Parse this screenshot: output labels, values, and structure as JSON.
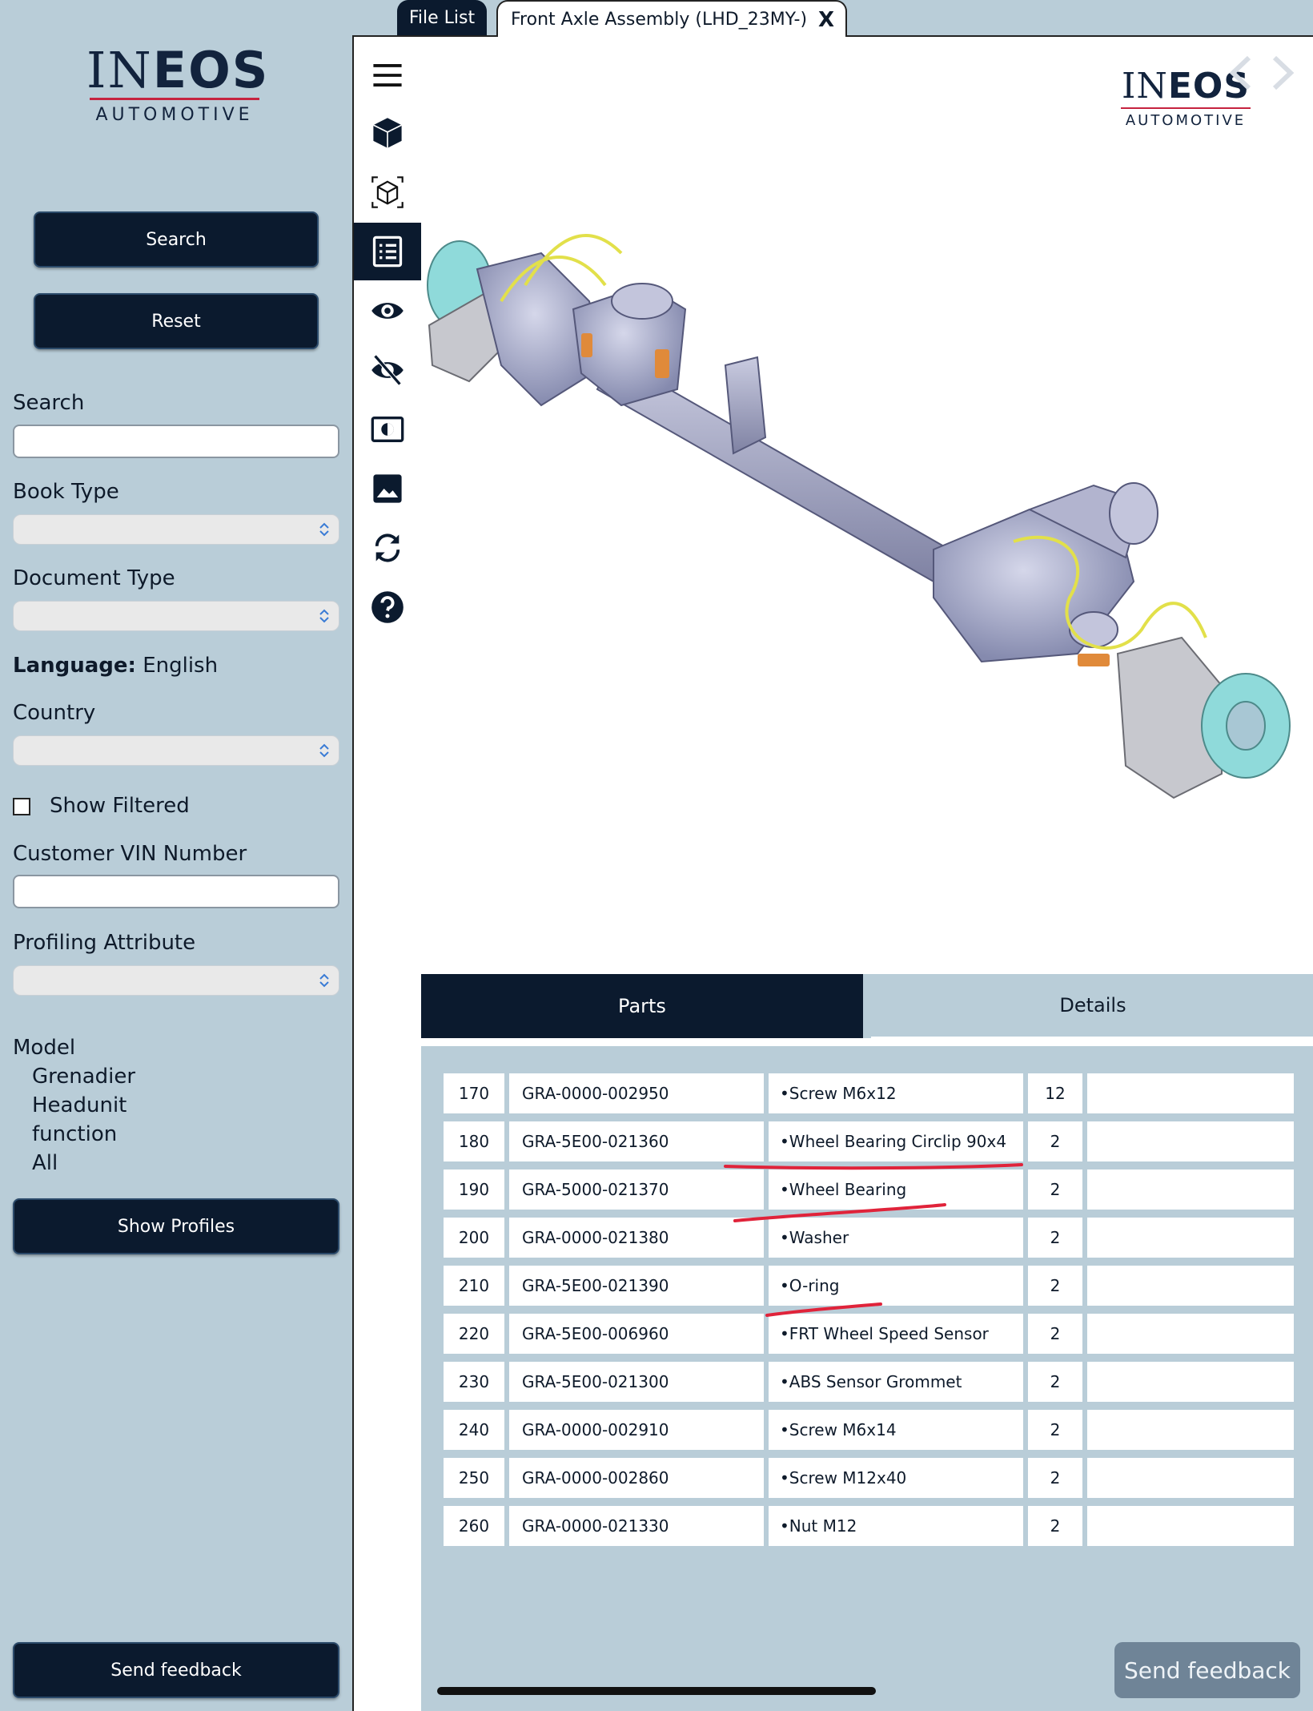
{
  "brand": {
    "name_light": "IN",
    "name_bold": "EOS",
    "subtitle": "AUTOMOTIVE"
  },
  "sidebar": {
    "search_button": "Search",
    "reset_button": "Reset",
    "search_label": "Search",
    "search_value": "",
    "book_type_label": "Book Type",
    "book_type_value": "",
    "document_type_label": "Document Type",
    "document_type_value": "",
    "language_label": "Language:",
    "language_value": "English",
    "country_label": "Country",
    "country_value": "",
    "show_filtered_label": "Show Filtered",
    "show_filtered_checked": false,
    "vin_label": "Customer VIN Number",
    "vin_value": "",
    "profiling_label": "Profiling Attribute",
    "profiling_value": "",
    "model_label": "Model",
    "model_items": [
      "Grenadier",
      "Headunit",
      "function",
      "All"
    ],
    "show_profiles_button": "Show  Profiles",
    "send_feedback_button": "Send feedback"
  },
  "tabs": {
    "file_list": "File List",
    "document": "Front Axle Assembly (LHD_23MY-)",
    "close": "X"
  },
  "toolbar": {
    "icons": [
      "menu-icon",
      "cube-solid-icon",
      "cube-wireframe-icon",
      "parts-list-icon",
      "show-icon",
      "hide-icon",
      "isolate-icon",
      "image-icon",
      "refresh-icon",
      "help-icon"
    ],
    "active": "parts-list-icon"
  },
  "viewer": {
    "model_description": "3D render of front axle assembly",
    "feedback_button": "Send feedback",
    "colors": {
      "housing": "#a7a9c9",
      "hub": "#8fdada",
      "wire": "#e2e04a",
      "bushing": "#e08a3a"
    }
  },
  "parts_panel": {
    "tab_parts": "Parts",
    "tab_details": "Details",
    "rows": [
      {
        "item": "170",
        "part": "GRA-0000-002950",
        "desc": "•Screw M6x12",
        "qty": "12"
      },
      {
        "item": "180",
        "part": "GRA-5E00-021360",
        "desc": "•Wheel Bearing Circlip 90x4",
        "qty": "2"
      },
      {
        "item": "190",
        "part": "GRA-5000-021370",
        "desc": "•Wheel Bearing",
        "qty": "2"
      },
      {
        "item": "200",
        "part": "GRA-0000-021380",
        "desc": "•Washer",
        "qty": "2"
      },
      {
        "item": "210",
        "part": "GRA-5E00-021390",
        "desc": "•O-ring",
        "qty": "2"
      },
      {
        "item": "220",
        "part": "GRA-5E00-006960",
        "desc": "•FRT Wheel Speed Sensor",
        "qty": "2"
      },
      {
        "item": "230",
        "part": "GRA-5E00-021300",
        "desc": "•ABS Sensor Grommet",
        "qty": "2"
      },
      {
        "item": "240",
        "part": "GRA-0000-002910",
        "desc": "•Screw M6x14",
        "qty": "2"
      },
      {
        "item": "250",
        "part": "GRA-0000-002860",
        "desc": "•Screw M12x40",
        "qty": "2"
      },
      {
        "item": "260",
        "part": "GRA-0000-021330",
        "desc": "•Nut M12",
        "qty": "2"
      }
    ],
    "annotation_color": "#e0233a"
  }
}
